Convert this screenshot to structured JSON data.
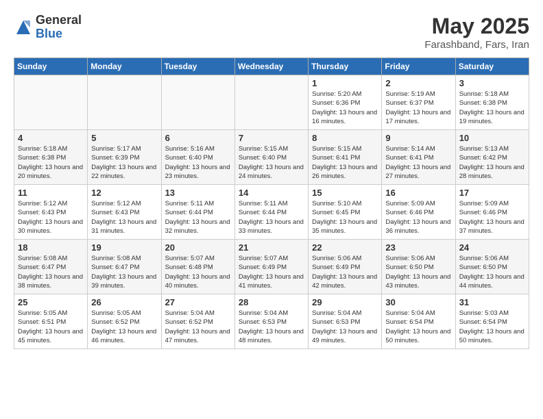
{
  "logo": {
    "general": "General",
    "blue": "Blue"
  },
  "header": {
    "month": "May 2025",
    "location": "Farashband, Fars, Iran"
  },
  "weekdays": [
    "Sunday",
    "Monday",
    "Tuesday",
    "Wednesday",
    "Thursday",
    "Friday",
    "Saturday"
  ],
  "weeks": [
    [
      {
        "day": "",
        "empty": true
      },
      {
        "day": "",
        "empty": true
      },
      {
        "day": "",
        "empty": true
      },
      {
        "day": "",
        "empty": true
      },
      {
        "day": "1",
        "sunrise": "5:20 AM",
        "sunset": "6:36 PM",
        "daylight": "13 hours and 16 minutes."
      },
      {
        "day": "2",
        "sunrise": "5:19 AM",
        "sunset": "6:37 PM",
        "daylight": "13 hours and 17 minutes."
      },
      {
        "day": "3",
        "sunrise": "5:18 AM",
        "sunset": "6:38 PM",
        "daylight": "13 hours and 19 minutes."
      }
    ],
    [
      {
        "day": "4",
        "sunrise": "5:18 AM",
        "sunset": "6:38 PM",
        "daylight": "13 hours and 20 minutes."
      },
      {
        "day": "5",
        "sunrise": "5:17 AM",
        "sunset": "6:39 PM",
        "daylight": "13 hours and 22 minutes."
      },
      {
        "day": "6",
        "sunrise": "5:16 AM",
        "sunset": "6:40 PM",
        "daylight": "13 hours and 23 minutes."
      },
      {
        "day": "7",
        "sunrise": "5:15 AM",
        "sunset": "6:40 PM",
        "daylight": "13 hours and 24 minutes."
      },
      {
        "day": "8",
        "sunrise": "5:15 AM",
        "sunset": "6:41 PM",
        "daylight": "13 hours and 26 minutes."
      },
      {
        "day": "9",
        "sunrise": "5:14 AM",
        "sunset": "6:41 PM",
        "daylight": "13 hours and 27 minutes."
      },
      {
        "day": "10",
        "sunrise": "5:13 AM",
        "sunset": "6:42 PM",
        "daylight": "13 hours and 28 minutes."
      }
    ],
    [
      {
        "day": "11",
        "sunrise": "5:12 AM",
        "sunset": "6:43 PM",
        "daylight": "13 hours and 30 minutes."
      },
      {
        "day": "12",
        "sunrise": "5:12 AM",
        "sunset": "6:43 PM",
        "daylight": "13 hours and 31 minutes."
      },
      {
        "day": "13",
        "sunrise": "5:11 AM",
        "sunset": "6:44 PM",
        "daylight": "13 hours and 32 minutes."
      },
      {
        "day": "14",
        "sunrise": "5:11 AM",
        "sunset": "6:44 PM",
        "daylight": "13 hours and 33 minutes."
      },
      {
        "day": "15",
        "sunrise": "5:10 AM",
        "sunset": "6:45 PM",
        "daylight": "13 hours and 35 minutes."
      },
      {
        "day": "16",
        "sunrise": "5:09 AM",
        "sunset": "6:46 PM",
        "daylight": "13 hours and 36 minutes."
      },
      {
        "day": "17",
        "sunrise": "5:09 AM",
        "sunset": "6:46 PM",
        "daylight": "13 hours and 37 minutes."
      }
    ],
    [
      {
        "day": "18",
        "sunrise": "5:08 AM",
        "sunset": "6:47 PM",
        "daylight": "13 hours and 38 minutes."
      },
      {
        "day": "19",
        "sunrise": "5:08 AM",
        "sunset": "6:47 PM",
        "daylight": "13 hours and 39 minutes."
      },
      {
        "day": "20",
        "sunrise": "5:07 AM",
        "sunset": "6:48 PM",
        "daylight": "13 hours and 40 minutes."
      },
      {
        "day": "21",
        "sunrise": "5:07 AM",
        "sunset": "6:49 PM",
        "daylight": "13 hours and 41 minutes."
      },
      {
        "day": "22",
        "sunrise": "5:06 AM",
        "sunset": "6:49 PM",
        "daylight": "13 hours and 42 minutes."
      },
      {
        "day": "23",
        "sunrise": "5:06 AM",
        "sunset": "6:50 PM",
        "daylight": "13 hours and 43 minutes."
      },
      {
        "day": "24",
        "sunrise": "5:06 AM",
        "sunset": "6:50 PM",
        "daylight": "13 hours and 44 minutes."
      }
    ],
    [
      {
        "day": "25",
        "sunrise": "5:05 AM",
        "sunset": "6:51 PM",
        "daylight": "13 hours and 45 minutes."
      },
      {
        "day": "26",
        "sunrise": "5:05 AM",
        "sunset": "6:52 PM",
        "daylight": "13 hours and 46 minutes."
      },
      {
        "day": "27",
        "sunrise": "5:04 AM",
        "sunset": "6:52 PM",
        "daylight": "13 hours and 47 minutes."
      },
      {
        "day": "28",
        "sunrise": "5:04 AM",
        "sunset": "6:53 PM",
        "daylight": "13 hours and 48 minutes."
      },
      {
        "day": "29",
        "sunrise": "5:04 AM",
        "sunset": "6:53 PM",
        "daylight": "13 hours and 49 minutes."
      },
      {
        "day": "30",
        "sunrise": "5:04 AM",
        "sunset": "6:54 PM",
        "daylight": "13 hours and 50 minutes."
      },
      {
        "day": "31",
        "sunrise": "5:03 AM",
        "sunset": "6:54 PM",
        "daylight": "13 hours and 50 minutes."
      }
    ]
  ]
}
